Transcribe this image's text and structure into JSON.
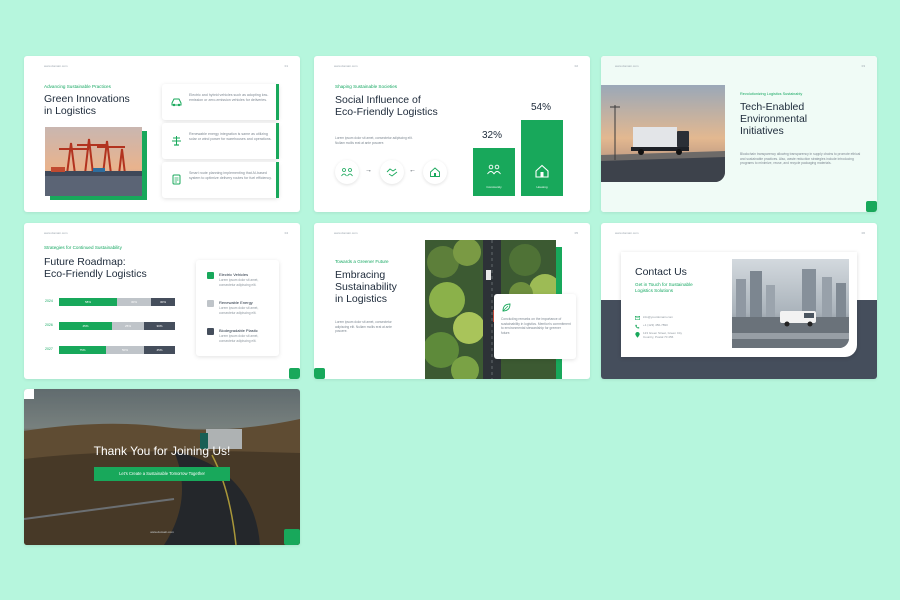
{
  "colors": {
    "background": "#b6f6dd",
    "accent": "#18a85b",
    "dark": "#454e5c"
  },
  "s1": {
    "url": "www.domain.com",
    "page": "01",
    "eyebrow": "Advancing Sustainable Practices",
    "title1": "Green Innovations",
    "title2": "in Logistics",
    "items": [
      {
        "icon": "electric-vehicle-icon",
        "text": "Electric and hybrid vehicles such as adopting low-emission or zero-emission vehicles for deliveries."
      },
      {
        "icon": "renewable-energy-icon",
        "text": "Renewable energy integration is same as utilizing solar or wind power for warehouses and operations."
      },
      {
        "icon": "route-planning-icon",
        "text": "Smart route planning implementing that AI-based system to optimize delivery routes for fuel efficiency."
      }
    ]
  },
  "s2": {
    "url": "www.domain.com",
    "page": "02",
    "eyebrow": "Shaping Sustainable Societies",
    "title1": "Social Influence of",
    "title2": "Eco-Friendly Logistics",
    "body": "Lorem ipsum dolor sit amet, consectetur adipiscing elit. Nullam mollis erat at ante posuere.",
    "stat1": {
      "value": "32%",
      "label": "Community"
    },
    "stat2": {
      "value": "54%",
      "label": "Housing"
    }
  },
  "s3": {
    "url": "www.domain.com",
    "page": "03",
    "eyebrow": "Revolutionizing Logistics Sustainably",
    "title1": "Tech-Enabled",
    "title2": "Environmental",
    "title3": "Initiatives",
    "body": "Blockchain transparency allowing transparency in supply chains to promote ethical and sustainable practices. Also, waste reduction strategies include introducing programs to minimize, reuse, and recycle packaging materials."
  },
  "s4": {
    "url": "www.domain.com",
    "page": "04",
    "eyebrow": "Strategies for Continued Sustainability",
    "title1": "Future Roadmap:",
    "title2": "Eco-Friendly Logistics",
    "rows": [
      {
        "year": "2024",
        "segments": [
          "58%",
          "30%",
          "30%"
        ]
      },
      {
        "year": "2026",
        "segments": [
          "45%",
          "25%",
          "30%"
        ]
      },
      {
        "year": "2027",
        "segments": [
          "75%",
          "50%",
          "45%"
        ]
      }
    ],
    "legend": [
      {
        "title": "Electric Vehicles",
        "body": "Lorem ipsum dolor sit amet, consectetur adipiscing elit."
      },
      {
        "title": "Renewable Energy",
        "body": "Lorem ipsum dolor sit amet, consectetur adipiscing elit."
      },
      {
        "title": "Biodegradable Plastic",
        "body": "Lorem ipsum dolor sit amet, consectetur adipiscing elit."
      }
    ]
  },
  "s5": {
    "url": "www.domain.com",
    "page": "05",
    "eyebrow": "Towards a Greener Future",
    "title1": "Embracing",
    "title2": "Sustainability",
    "title3": "in Logistics",
    "body": "Lorem ipsum dolor sit amet, consectetur adipiscing elit. Nullam mollis erat at ante posuere.",
    "card": "Concluding remarks on the importance of sustainability in logistics. Mention's commitment to environmental stewardship for greener future."
  },
  "s6": {
    "url": "www.domain.com",
    "page": "06",
    "title": "Contact Us",
    "subtitle1": "Get in Touch for Sustainable",
    "subtitle2": "Logistics Solutions",
    "email": "info@yourdomain.com",
    "phone": "+1 (123) 456-7890",
    "address1": "123 Green Street, Green City",
    "address2": "Country, Postal 70 456"
  },
  "s7": {
    "title": "Thank You for Joining Us!",
    "cta": "Let's Create a Sustainable Tomorrow Together",
    "url": "www.domain.com"
  }
}
